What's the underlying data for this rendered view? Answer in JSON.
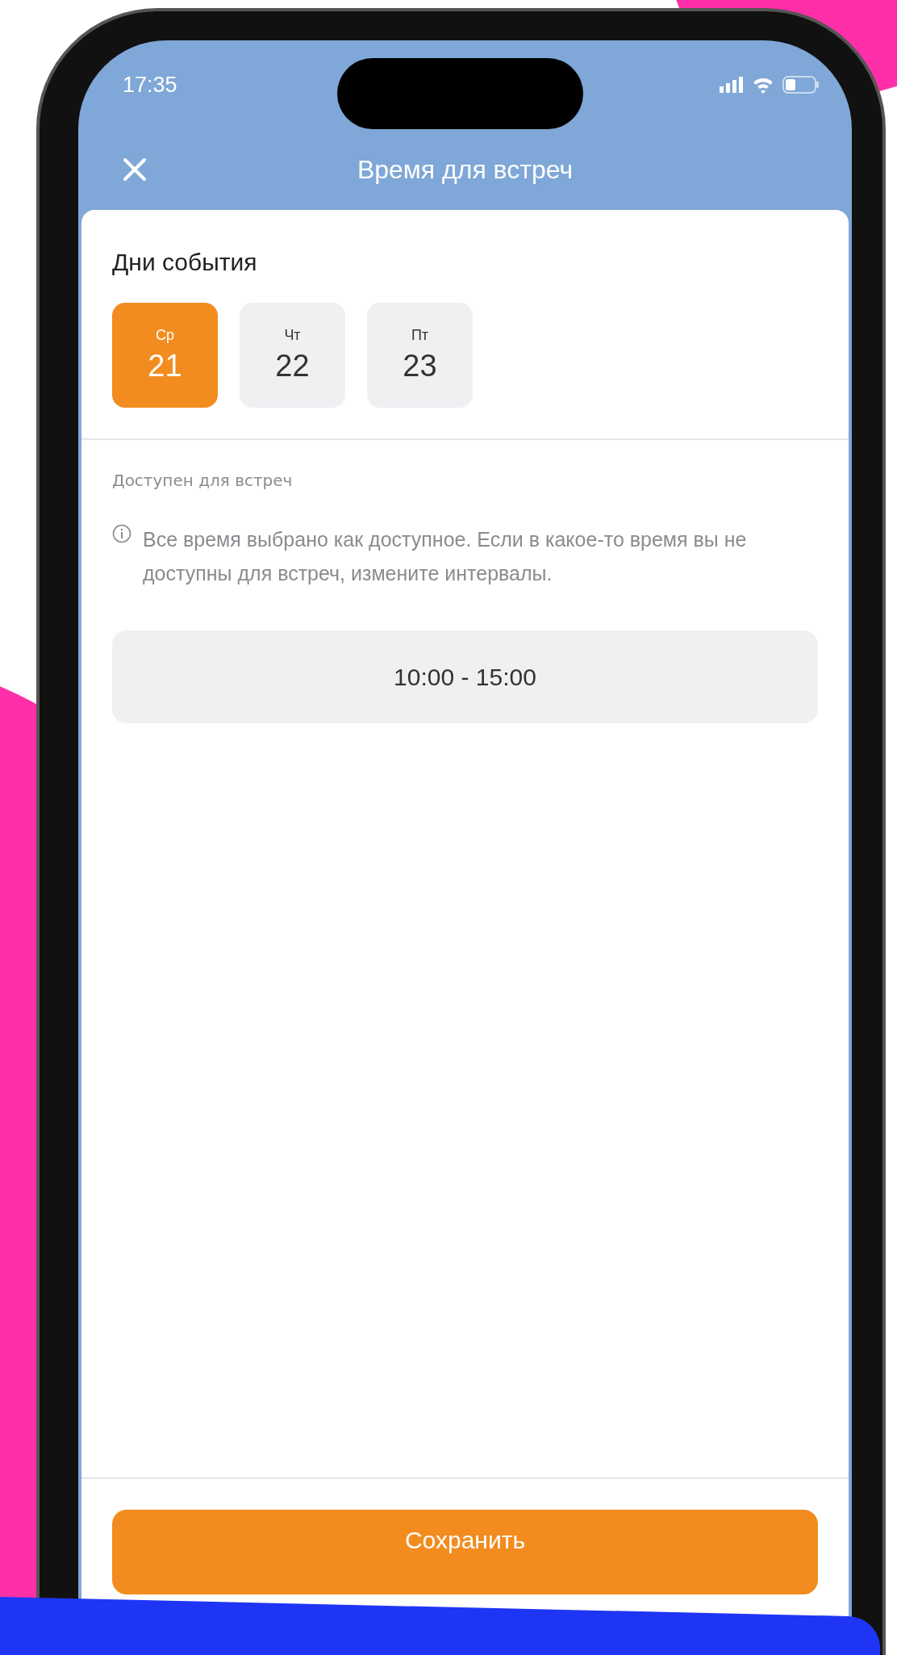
{
  "status_bar": {
    "time": "17:35"
  },
  "header": {
    "title": "Время для встреч"
  },
  "days_section": {
    "title": "Дни события",
    "days": [
      {
        "weekday": "Ср",
        "date": "21",
        "selected": true
      },
      {
        "weekday": "Чт",
        "date": "22",
        "selected": false
      },
      {
        "weekday": "Пт",
        "date": "23",
        "selected": false
      }
    ]
  },
  "availability": {
    "label": "Доступен для встреч",
    "info": "Все время выбрано как доступное. Если в какое-то время вы не доступны для встреч, измените интервалы.",
    "intervals": [
      "10:00 - 15:00"
    ]
  },
  "save_button": {
    "label": "Сохранить"
  }
}
